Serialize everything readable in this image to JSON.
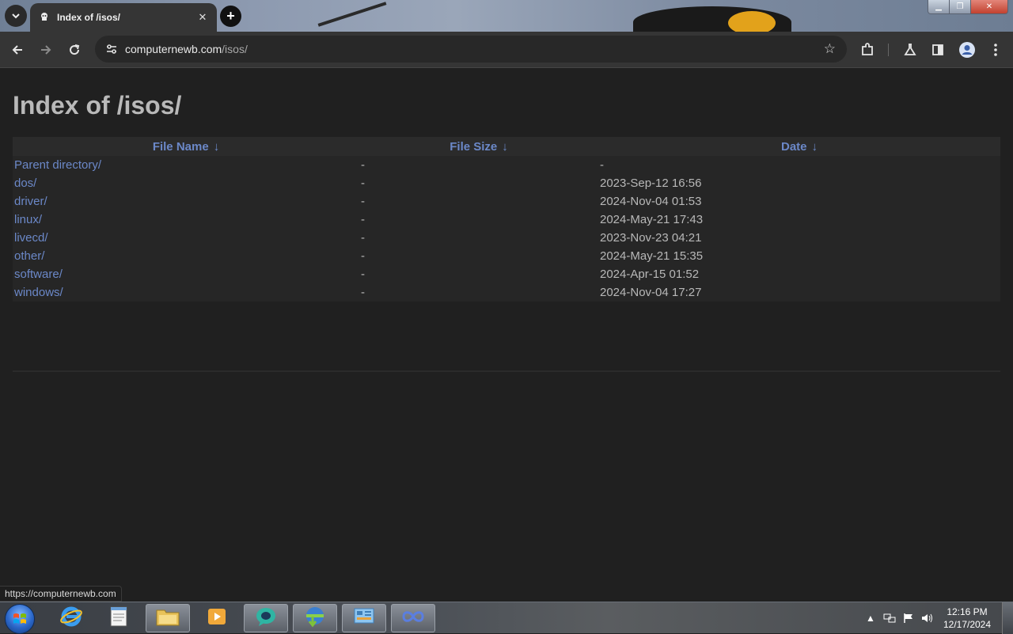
{
  "browser": {
    "tab": {
      "title": "Index of /isos/",
      "favicon": "pirate-flag-icon"
    },
    "address": {
      "host": "computernewb.com",
      "path": "/isos/"
    },
    "status_url": "https://computernewb.com"
  },
  "page": {
    "title": "Index of /isos/",
    "columns": [
      {
        "label": "File Name",
        "arrow": "↓"
      },
      {
        "label": "File Size",
        "arrow": "↓"
      },
      {
        "label": "Date",
        "arrow": "↓"
      }
    ],
    "rows": [
      {
        "name": "Parent directory/",
        "size": "-",
        "date": "-"
      },
      {
        "name": "dos/",
        "size": "-",
        "date": "2023-Sep-12 16:56"
      },
      {
        "name": "driver/",
        "size": "-",
        "date": "2024-Nov-04 01:53"
      },
      {
        "name": "linux/",
        "size": "-",
        "date": "2024-May-21 17:43"
      },
      {
        "name": "livecd/",
        "size": "-",
        "date": "2023-Nov-23 04:21"
      },
      {
        "name": "other/",
        "size": "-",
        "date": "2024-May-21 15:35"
      },
      {
        "name": "software/",
        "size": "-",
        "date": "2024-Apr-15 01:52"
      },
      {
        "name": "windows/",
        "size": "-",
        "date": "2024-Nov-04 17:27"
      }
    ]
  },
  "taskbar": {
    "apps": [
      {
        "icon": "internet-explorer-icon"
      },
      {
        "icon": "notepad-icon"
      },
      {
        "icon": "file-explorer-icon"
      },
      {
        "icon": "media-player-icon"
      },
      {
        "icon": "chat-bubble-icon"
      },
      {
        "icon": "download-manager-icon"
      },
      {
        "icon": "control-panel-icon"
      },
      {
        "icon": "infinity-app-icon"
      }
    ],
    "clock": {
      "time": "12:16 PM",
      "date": "12/17/2024"
    }
  },
  "colors": {
    "link": "#6b88c8",
    "page_bg": "#202020",
    "text": "#b8b8b8"
  }
}
